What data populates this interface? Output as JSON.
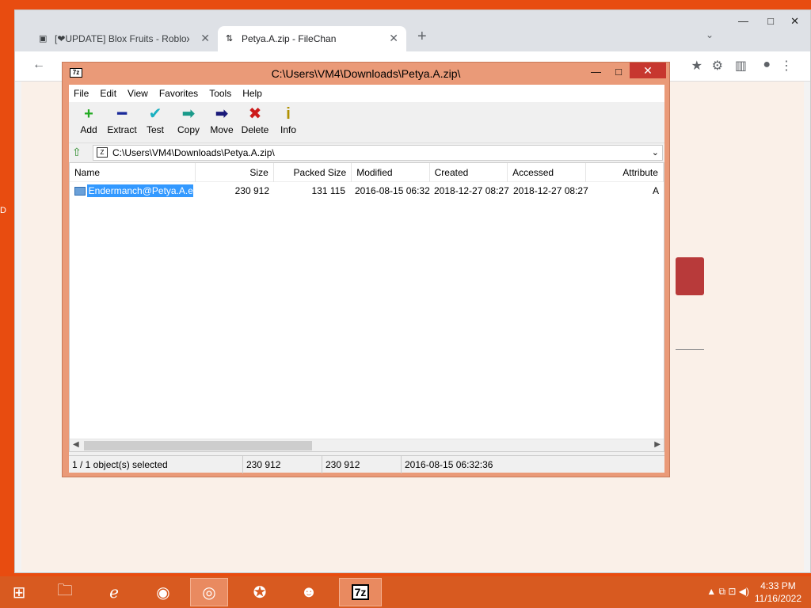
{
  "browser": {
    "tabs": [
      {
        "label": "[❤UPDATE] Blox Fruits - Roblox",
        "active": false
      },
      {
        "label": "Petya.A.zip - FileChan",
        "active": true
      }
    ],
    "new_tab": "+",
    "tab_close": "✕",
    "window_controls": {
      "minimize": "—",
      "maximize": "□",
      "close": "✕"
    },
    "toolbar": {
      "back": "←",
      "ext": "★",
      "puzzle": "⚙",
      "sidepanel": "▥",
      "profile": "●",
      "menu": "⋮"
    }
  },
  "sevenzip": {
    "title": "C:\\Users\\VM4\\Downloads\\Petya.A.zip\\",
    "app_icon": "7z",
    "controls": {
      "minimize": "—",
      "maximize": "□",
      "close": "✕"
    },
    "menu": [
      "File",
      "Edit",
      "View",
      "Favorites",
      "Tools",
      "Help"
    ],
    "tools": [
      {
        "label": "Add",
        "icon": "plus-icon",
        "glyph": "+",
        "color": "#22aa22"
      },
      {
        "label": "Extract",
        "icon": "minus-icon",
        "glyph": "━",
        "color": "#1a2a9a"
      },
      {
        "label": "Test",
        "icon": "check-icon",
        "glyph": "✔",
        "color": "#1ab0c0"
      },
      {
        "label": "Copy",
        "icon": "copy-arrow-icon",
        "glyph": "➡",
        "color": "#1a9a8a"
      },
      {
        "label": "Move",
        "icon": "move-arrow-icon",
        "glyph": "➡",
        "color": "#1a1a7a"
      },
      {
        "label": "Delete",
        "icon": "delete-x-icon",
        "glyph": "✖",
        "color": "#cc1a1a"
      },
      {
        "label": "Info",
        "icon": "info-icon",
        "glyph": "i",
        "color": "#b09000"
      }
    ],
    "address": "C:\\Users\\VM4\\Downloads\\Petya.A.zip\\",
    "columns": [
      "Name",
      "Size",
      "Packed Size",
      "Modified",
      "Created",
      "Accessed",
      "Attribute"
    ],
    "rows": [
      {
        "name": "Endermanch@Petya.A.e...",
        "size": "230 912",
        "packed": "131 115",
        "modified": "2016-08-15 06:32",
        "created": "2018-12-27 08:27",
        "accessed": "2018-12-27 08:27",
        "attr": "A"
      }
    ],
    "status": {
      "selected": "1 / 1 object(s) selected",
      "size": "230 912",
      "packed": "230 912",
      "date": "2016-08-15 06:32:36"
    }
  },
  "taskbar": {
    "clock_time": "4:33 PM",
    "clock_date": "11/16/2022",
    "sevenzip_label": "7z"
  },
  "desktop_fragments": {
    "left_letters": "D"
  }
}
